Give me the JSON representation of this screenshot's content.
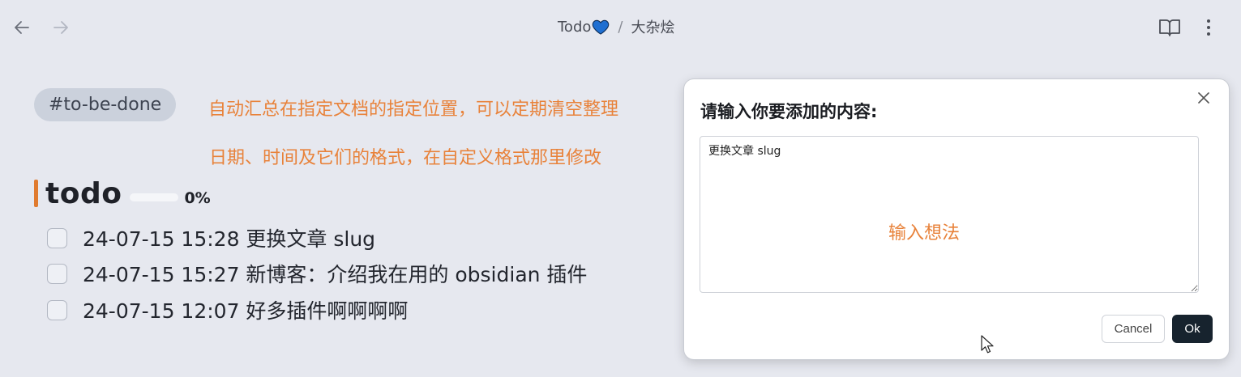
{
  "topbar": {
    "back_icon": "arrow-left-icon",
    "forward_icon": "arrow-right-icon",
    "breadcrumb": [
      "Todo",
      "大杂烩"
    ],
    "separator": "/",
    "heart_color": "#1f6fd1",
    "reading_icon": "book-open-icon",
    "more_icon": "more-vertical-icon"
  },
  "content": {
    "tag": "#to-be-done",
    "annotations": [
      "自动汇总在指定文档的指定位置，可以定期清空整理",
      "日期、时间及它们的格式，在自定义格式那里修改"
    ],
    "heading": "todo",
    "progress_percent": "0%",
    "progress_value": 0,
    "tasks": [
      {
        "text": "24-07-15 15:28 更换文章 slug",
        "checked": false
      },
      {
        "text": "24-07-15 15:27 新博客：介绍我在用的 obsidian 插件",
        "checked": false
      },
      {
        "text": "24-07-15 12:07 好多插件啊啊啊啊",
        "checked": false
      }
    ]
  },
  "modal": {
    "title": "请输入你要添加的内容:",
    "textarea_value": "更换文章 slug",
    "hint": "输入想法",
    "cancel_label": "Cancel",
    "ok_label": "Ok",
    "close_icon": "close-icon"
  },
  "colors": {
    "accent_orange": "#e8823a",
    "ok_button": "#17232e",
    "background": "#e6e8ef"
  }
}
